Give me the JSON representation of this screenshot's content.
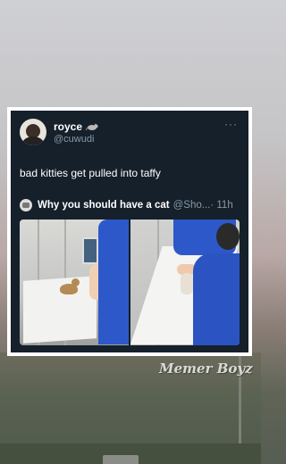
{
  "tweet": {
    "display_name": "royce",
    "name_emoji": "rat-icon",
    "handle": "@cuwudi",
    "text": "bad kitties get pulled into taffy",
    "more_icon": "more-icon"
  },
  "quoted_tweet": {
    "name": "Why you should have a cat",
    "handle": "@Sho...",
    "time": "· 11h",
    "media_count": 2
  },
  "watermark": "Memer Boyz",
  "colors": {
    "tweet_bg": "#15202b",
    "secondary_text": "#8899a6",
    "scrubs_blue": "#2d58c9"
  }
}
